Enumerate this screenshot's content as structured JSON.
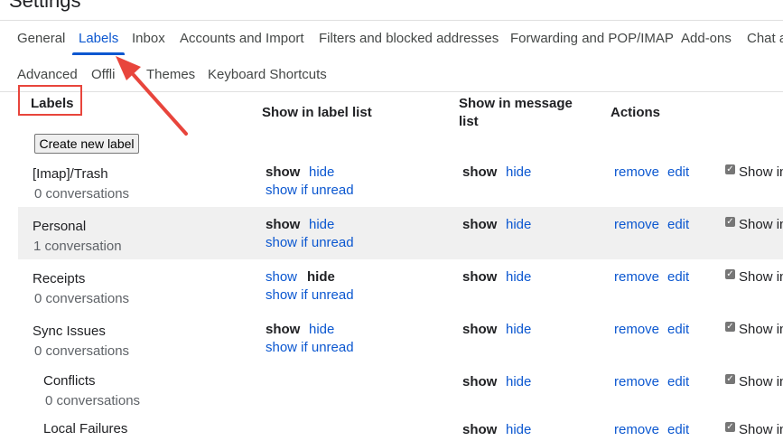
{
  "page": {
    "title": "Settings"
  },
  "tabs_row1": [
    {
      "label": "General"
    },
    {
      "label": "Labels"
    },
    {
      "label": "Inbox"
    },
    {
      "label": "Accounts and Import"
    },
    {
      "label": "Filters and blocked addresses"
    },
    {
      "label": "Forwarding and POP/IMAP"
    },
    {
      "label": "Add-ons"
    },
    {
      "label": "Chat a"
    }
  ],
  "tabs_row2": [
    {
      "label": "Advanced"
    },
    {
      "label": "Offli"
    },
    {
      "label": "Themes"
    },
    {
      "label": "Keyboard Shortcuts"
    }
  ],
  "headers": {
    "labels": "Labels",
    "show_in_label_list": "Show in label list",
    "show_in_message_list_line1": "Show in message",
    "show_in_message_list_line2": "list",
    "actions": "Actions"
  },
  "create_button": "Create new label",
  "strings": {
    "show": "show",
    "hide": "hide",
    "show_if_unread": "show if unread",
    "remove": "remove",
    "edit": "edit",
    "show_in": "Show in"
  },
  "rows": [
    {
      "name": "[Imap]/Trash",
      "count": "0 conversations"
    },
    {
      "name": "Personal",
      "count": "1 conversation"
    },
    {
      "name": "Receipts",
      "count": "0 conversations"
    },
    {
      "name": "Sync Issues",
      "count": "0 conversations"
    },
    {
      "name": "Conflicts",
      "count": "0 conversations"
    },
    {
      "name": "Local Failures",
      "count": ""
    }
  ],
  "annotation": {
    "highlight_color": "#e8453c"
  }
}
